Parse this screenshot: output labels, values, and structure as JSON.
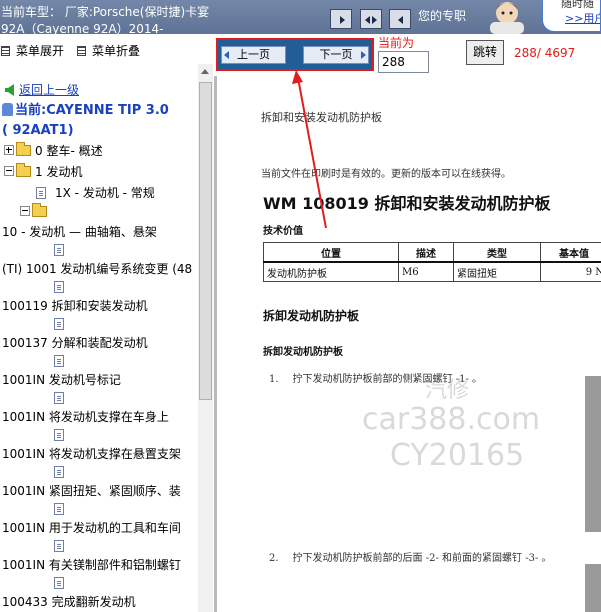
{
  "header": {
    "line1": "当前车型： 厂家:Porsche(保时捷)卡宴",
    "line2": "92A（Cayenne 92A）2014-",
    "tip": "您的专职",
    "ad_line1": "随时随",
    "ad_link": ">>用户"
  },
  "sidebar": {
    "menu_expand": "菜单展开",
    "menu_collapse": "菜单折叠",
    "back_label": "返回上一级",
    "current_model": "当前:CAYENNE TIP 3.0",
    "current_code": "( 92AAT1)",
    "tree": [
      {
        "label": "0 整车- 概述"
      },
      {
        "label": "1 发动机"
      },
      {
        "label": "1X - 发动机 - 常规"
      },
      {
        "label": ""
      },
      {
        "label": "10 - 发动机 — 曲轴箱、悬架"
      },
      {
        "label": "(TI) 1001 发动机编号系统变更 (48"
      },
      {
        "label": "100119 拆卸和安装发动机"
      },
      {
        "label": "100137 分解和装配发动机"
      },
      {
        "label": "1001IN 发动机号标记"
      },
      {
        "label": "1001IN 将发动机支撑在车身上"
      },
      {
        "label": "1001IN 将发动机支撑在悬置支架"
      },
      {
        "label": "1001IN 紧固扭矩、紧固顺序、装"
      },
      {
        "label": "1001IN 用于发动机的工具和车间"
      },
      {
        "label": "1001IN 有关镁制部件和铝制螺钉"
      },
      {
        "label": "100433 完成翻新发动机"
      }
    ]
  },
  "toolbar": {
    "prev_label": "上一页",
    "next_label": "下一页",
    "current_label": "当前为",
    "page_value": "288",
    "jump_label": "跳转",
    "page_count": "288/ 4697"
  },
  "document": {
    "small_title": "拆卸和安装发动机防护板",
    "note": "当前文件在印刷时是有效的。更新的版本可以在线获得。",
    "title": "WM 108019 拆卸和安装发动机防护板",
    "spec_heading": "技术价值",
    "spec_table": {
      "headers": [
        "位置",
        "描述",
        "类型",
        "基本值"
      ],
      "rows": [
        [
          "发动机防护板",
          "M6",
          "紧固扭矩",
          "9 N"
        ]
      ]
    },
    "section_heading": "拆卸发动机防护板",
    "sub_heading": "拆卸发动机防护板",
    "steps": [
      {
        "num": "1.",
        "text": "拧下发动机防护板前部的侧紧固螺钉 -1- 。"
      },
      {
        "num": "2.",
        "text": "拧下发动机防护板前部的后面 -2- 和前面的紧固螺钉 -3- 。"
      }
    ],
    "watermark": {
      "line1": "汽修",
      "line2": "car388.com",
      "line3": "CY20165"
    }
  }
}
